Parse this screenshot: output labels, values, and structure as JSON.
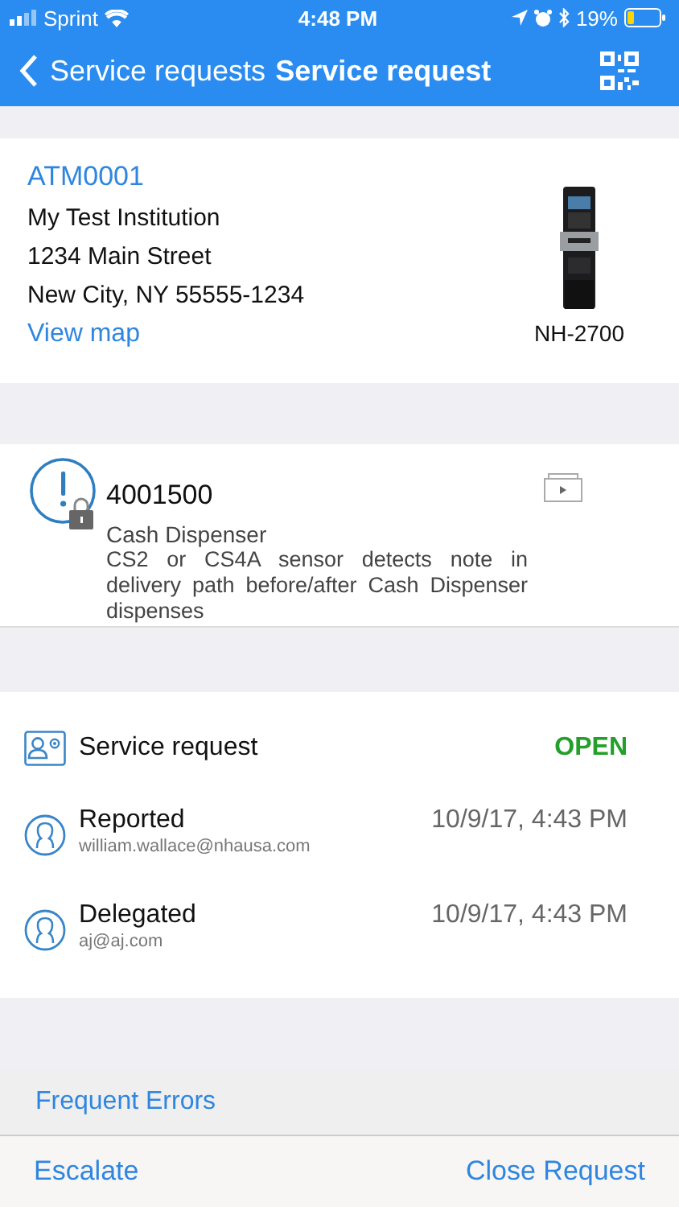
{
  "status_bar": {
    "carrier": "Sprint",
    "time": "4:48 PM",
    "battery": "19%"
  },
  "nav": {
    "back": "Service requests",
    "title": "Service request"
  },
  "atm": {
    "id": "ATM0001",
    "address_lines": [
      "My Test Institution",
      "1234 Main Street",
      "New City, NY 55555-1234"
    ],
    "map_link": "View map",
    "model": "NH-2700"
  },
  "error": {
    "locked": true,
    "code": "4001500",
    "category": "Cash Dispenser",
    "description": "CS2 or CS4A sensor detects note in delivery path before/after Cash Dispenser dispenses"
  },
  "request": {
    "title": "Service request",
    "status": "OPEN",
    "events": [
      {
        "label": "Reported",
        "user": "william.wallace@nhausa.com",
        "time": "10/9/17, 4:43 PM"
      },
      {
        "label": "Delegated",
        "user": "aj@aj.com",
        "time": "10/9/17, 4:43 PM"
      }
    ]
  },
  "frequent_errors": "Frequent Errors",
  "actions": [
    {
      "label": "Escalate"
    },
    {
      "label": "Close Request"
    }
  ]
}
